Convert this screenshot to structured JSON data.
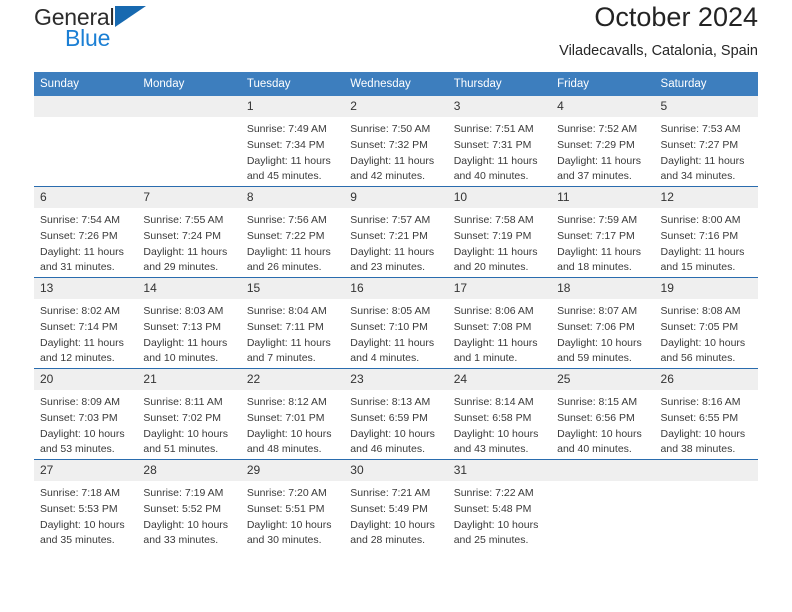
{
  "brand": {
    "name_part1": "General",
    "name_part2": "Blue",
    "triangle_color": "#1769b0",
    "blue_color": "#1b7fd4"
  },
  "header": {
    "title": "October 2024",
    "location": "Viladecavalls, Catalonia, Spain"
  },
  "theme": {
    "header_blue": "#3d7ebe",
    "row_divider_blue": "#2a6cae",
    "daynum_background": "#efefef"
  },
  "weekday_headers": [
    "Sunday",
    "Monday",
    "Tuesday",
    "Wednesday",
    "Thursday",
    "Friday",
    "Saturday"
  ],
  "weeks": [
    [
      {
        "day": "",
        "sunrise": "",
        "sunset": "",
        "daylight1": "",
        "daylight2": ""
      },
      {
        "day": "",
        "sunrise": "",
        "sunset": "",
        "daylight1": "",
        "daylight2": ""
      },
      {
        "day": "1",
        "sunrise": "Sunrise: 7:49 AM",
        "sunset": "Sunset: 7:34 PM",
        "daylight1": "Daylight: 11 hours",
        "daylight2": "and 45 minutes."
      },
      {
        "day": "2",
        "sunrise": "Sunrise: 7:50 AM",
        "sunset": "Sunset: 7:32 PM",
        "daylight1": "Daylight: 11 hours",
        "daylight2": "and 42 minutes."
      },
      {
        "day": "3",
        "sunrise": "Sunrise: 7:51 AM",
        "sunset": "Sunset: 7:31 PM",
        "daylight1": "Daylight: 11 hours",
        "daylight2": "and 40 minutes."
      },
      {
        "day": "4",
        "sunrise": "Sunrise: 7:52 AM",
        "sunset": "Sunset: 7:29 PM",
        "daylight1": "Daylight: 11 hours",
        "daylight2": "and 37 minutes."
      },
      {
        "day": "5",
        "sunrise": "Sunrise: 7:53 AM",
        "sunset": "Sunset: 7:27 PM",
        "daylight1": "Daylight: 11 hours",
        "daylight2": "and 34 minutes."
      }
    ],
    [
      {
        "day": "6",
        "sunrise": "Sunrise: 7:54 AM",
        "sunset": "Sunset: 7:26 PM",
        "daylight1": "Daylight: 11 hours",
        "daylight2": "and 31 minutes."
      },
      {
        "day": "7",
        "sunrise": "Sunrise: 7:55 AM",
        "sunset": "Sunset: 7:24 PM",
        "daylight1": "Daylight: 11 hours",
        "daylight2": "and 29 minutes."
      },
      {
        "day": "8",
        "sunrise": "Sunrise: 7:56 AM",
        "sunset": "Sunset: 7:22 PM",
        "daylight1": "Daylight: 11 hours",
        "daylight2": "and 26 minutes."
      },
      {
        "day": "9",
        "sunrise": "Sunrise: 7:57 AM",
        "sunset": "Sunset: 7:21 PM",
        "daylight1": "Daylight: 11 hours",
        "daylight2": "and 23 minutes."
      },
      {
        "day": "10",
        "sunrise": "Sunrise: 7:58 AM",
        "sunset": "Sunset: 7:19 PM",
        "daylight1": "Daylight: 11 hours",
        "daylight2": "and 20 minutes."
      },
      {
        "day": "11",
        "sunrise": "Sunrise: 7:59 AM",
        "sunset": "Sunset: 7:17 PM",
        "daylight1": "Daylight: 11 hours",
        "daylight2": "and 18 minutes."
      },
      {
        "day": "12",
        "sunrise": "Sunrise: 8:00 AM",
        "sunset": "Sunset: 7:16 PM",
        "daylight1": "Daylight: 11 hours",
        "daylight2": "and 15 minutes."
      }
    ],
    [
      {
        "day": "13",
        "sunrise": "Sunrise: 8:02 AM",
        "sunset": "Sunset: 7:14 PM",
        "daylight1": "Daylight: 11 hours",
        "daylight2": "and 12 minutes."
      },
      {
        "day": "14",
        "sunrise": "Sunrise: 8:03 AM",
        "sunset": "Sunset: 7:13 PM",
        "daylight1": "Daylight: 11 hours",
        "daylight2": "and 10 minutes."
      },
      {
        "day": "15",
        "sunrise": "Sunrise: 8:04 AM",
        "sunset": "Sunset: 7:11 PM",
        "daylight1": "Daylight: 11 hours",
        "daylight2": "and 7 minutes."
      },
      {
        "day": "16",
        "sunrise": "Sunrise: 8:05 AM",
        "sunset": "Sunset: 7:10 PM",
        "daylight1": "Daylight: 11 hours",
        "daylight2": "and 4 minutes."
      },
      {
        "day": "17",
        "sunrise": "Sunrise: 8:06 AM",
        "sunset": "Sunset: 7:08 PM",
        "daylight1": "Daylight: 11 hours",
        "daylight2": "and 1 minute."
      },
      {
        "day": "18",
        "sunrise": "Sunrise: 8:07 AM",
        "sunset": "Sunset: 7:06 PM",
        "daylight1": "Daylight: 10 hours",
        "daylight2": "and 59 minutes."
      },
      {
        "day": "19",
        "sunrise": "Sunrise: 8:08 AM",
        "sunset": "Sunset: 7:05 PM",
        "daylight1": "Daylight: 10 hours",
        "daylight2": "and 56 minutes."
      }
    ],
    [
      {
        "day": "20",
        "sunrise": "Sunrise: 8:09 AM",
        "sunset": "Sunset: 7:03 PM",
        "daylight1": "Daylight: 10 hours",
        "daylight2": "and 53 minutes."
      },
      {
        "day": "21",
        "sunrise": "Sunrise: 8:11 AM",
        "sunset": "Sunset: 7:02 PM",
        "daylight1": "Daylight: 10 hours",
        "daylight2": "and 51 minutes."
      },
      {
        "day": "22",
        "sunrise": "Sunrise: 8:12 AM",
        "sunset": "Sunset: 7:01 PM",
        "daylight1": "Daylight: 10 hours",
        "daylight2": "and 48 minutes."
      },
      {
        "day": "23",
        "sunrise": "Sunrise: 8:13 AM",
        "sunset": "Sunset: 6:59 PM",
        "daylight1": "Daylight: 10 hours",
        "daylight2": "and 46 minutes."
      },
      {
        "day": "24",
        "sunrise": "Sunrise: 8:14 AM",
        "sunset": "Sunset: 6:58 PM",
        "daylight1": "Daylight: 10 hours",
        "daylight2": "and 43 minutes."
      },
      {
        "day": "25",
        "sunrise": "Sunrise: 8:15 AM",
        "sunset": "Sunset: 6:56 PM",
        "daylight1": "Daylight: 10 hours",
        "daylight2": "and 40 minutes."
      },
      {
        "day": "26",
        "sunrise": "Sunrise: 8:16 AM",
        "sunset": "Sunset: 6:55 PM",
        "daylight1": "Daylight: 10 hours",
        "daylight2": "and 38 minutes."
      }
    ],
    [
      {
        "day": "27",
        "sunrise": "Sunrise: 7:18 AM",
        "sunset": "Sunset: 5:53 PM",
        "daylight1": "Daylight: 10 hours",
        "daylight2": "and 35 minutes."
      },
      {
        "day": "28",
        "sunrise": "Sunrise: 7:19 AM",
        "sunset": "Sunset: 5:52 PM",
        "daylight1": "Daylight: 10 hours",
        "daylight2": "and 33 minutes."
      },
      {
        "day": "29",
        "sunrise": "Sunrise: 7:20 AM",
        "sunset": "Sunset: 5:51 PM",
        "daylight1": "Daylight: 10 hours",
        "daylight2": "and 30 minutes."
      },
      {
        "day": "30",
        "sunrise": "Sunrise: 7:21 AM",
        "sunset": "Sunset: 5:49 PM",
        "daylight1": "Daylight: 10 hours",
        "daylight2": "and 28 minutes."
      },
      {
        "day": "31",
        "sunrise": "Sunrise: 7:22 AM",
        "sunset": "Sunset: 5:48 PM",
        "daylight1": "Daylight: 10 hours",
        "daylight2": "and 25 minutes."
      },
      {
        "day": "",
        "sunrise": "",
        "sunset": "",
        "daylight1": "",
        "daylight2": ""
      },
      {
        "day": "",
        "sunrise": "",
        "sunset": "",
        "daylight1": "",
        "daylight2": ""
      }
    ]
  ]
}
